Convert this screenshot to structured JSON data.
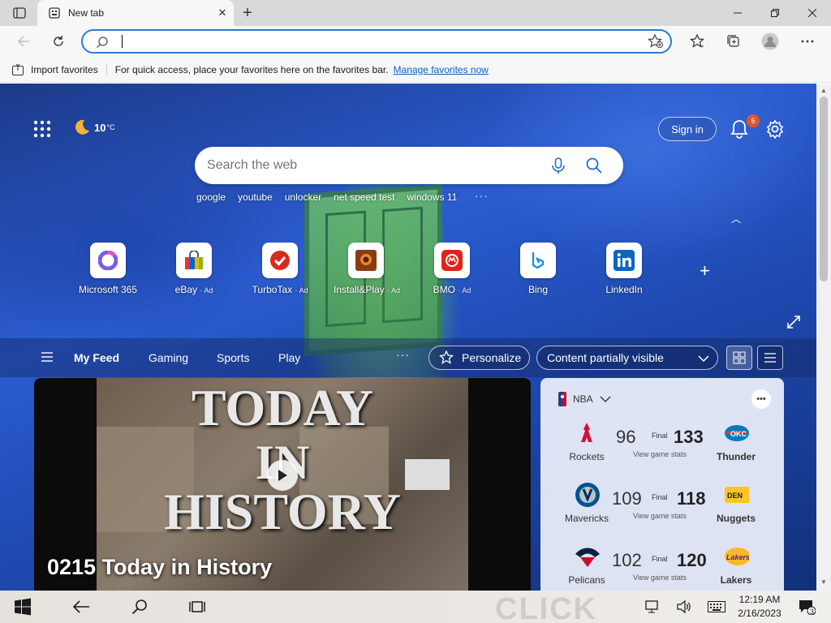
{
  "browser": {
    "tab_title": "New tab",
    "address_placeholder": ""
  },
  "favorites_bar": {
    "import_label": "Import favorites",
    "hint_text": "For quick access, place your favorites here on the favorites bar.",
    "manage_link": "Manage favorites now"
  },
  "ntp": {
    "weather_temp": "10",
    "weather_unit": "°C",
    "sign_in": "Sign in",
    "notification_count": "6",
    "search_placeholder": "Search the web",
    "trending": [
      "google",
      "youtube",
      "unlocker",
      "net speed test",
      "windows 11"
    ],
    "quick_links": [
      {
        "label": "Microsoft 365",
        "ad": ""
      },
      {
        "label": "eBay",
        "ad": "· Ad"
      },
      {
        "label": "TurboTax",
        "ad": "· Ad"
      },
      {
        "label": "Install&Play",
        "ad": "· Ad"
      },
      {
        "label": "BMO",
        "ad": "· Ad"
      },
      {
        "label": "Bing",
        "ad": ""
      },
      {
        "label": "LinkedIn",
        "ad": ""
      }
    ]
  },
  "feed": {
    "tabs": [
      "My Feed",
      "Gaming",
      "Sports",
      "Play"
    ],
    "personalize": "Personalize",
    "visibility": "Content partially visible",
    "hero": {
      "big_line1": "TODAY",
      "big_line2": "IN",
      "big_line3": "HISTORY",
      "title": "0215 Today in History"
    },
    "sports": {
      "league": "NBA",
      "final_label": "Final",
      "stats_label": "View game stats",
      "games": [
        {
          "home": "Rockets",
          "home_score": "96",
          "away": "Thunder",
          "away_score": "133"
        },
        {
          "home": "Mavericks",
          "home_score": "109",
          "away": "Nuggets",
          "away_score": "118"
        },
        {
          "home": "Pelicans",
          "home_score": "102",
          "away": "Lakers",
          "away_score": "120"
        }
      ]
    }
  },
  "taskbar": {
    "time": "12:19 AM",
    "date": "2/16/2023",
    "notif_count": "3",
    "bg_text": "CLICK"
  },
  "colors": {
    "accent": "#2b7bd6",
    "link": "#0a5fc4",
    "badge": "#e5532a"
  }
}
